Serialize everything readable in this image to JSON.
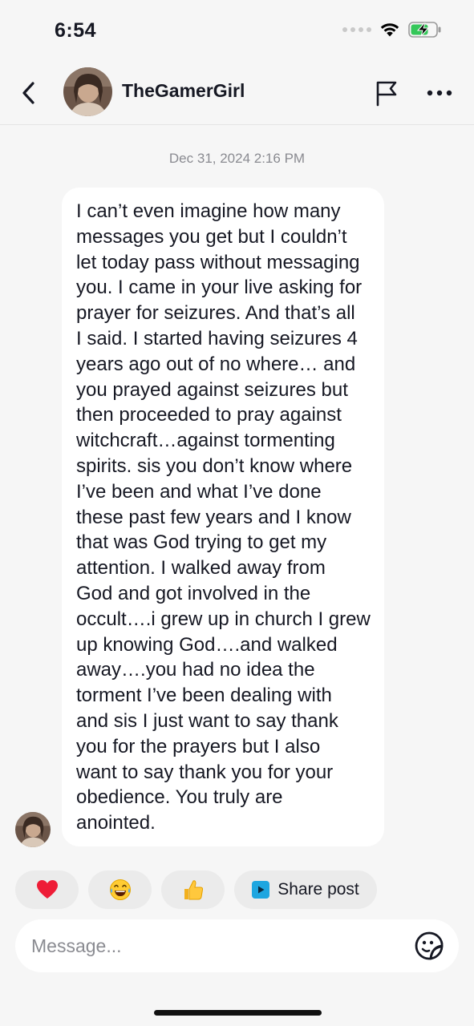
{
  "status_bar": {
    "time": "6:54",
    "icons": [
      "signal-dots-icon",
      "wifi-icon",
      "battery-charging-icon"
    ],
    "battery_color": "#34c759"
  },
  "header": {
    "username": "TheGamerGirl",
    "icons": [
      "back-chevron-icon",
      "avatar",
      "flag-icon",
      "more-horizontal-icon"
    ]
  },
  "chat": {
    "timestamp": "Dec 31, 2024 2:16 PM",
    "message_lines": [
      "I can’t even imagine how many",
      "messages you get but I couldn’t",
      "let today pass without messaging",
      "you. I came in your live asking for",
      "prayer for seizures. And that’s all",
      "I said. I started having seizures 4",
      "years ago out of no where… and",
      "you prayed against seizures  but",
      "then proceeded to pray against",
      "witchcraft…against tormenting",
      "spirits. sis you don’t know where",
      "I’ve been and what I’ve done",
      "these past few years and I know",
      "that was God trying to get my",
      "attention. I walked away from",
      "God and got involved in the",
      "occult….i grew up in church I grew",
      "up knowing God….and walked",
      "away….you had no idea the",
      "torment I’ve been dealing with",
      "and sis I just want to say thank",
      "you for the prayers but I also",
      "want to say thank you for your",
      "obedience. You truly are",
      "anointed."
    ]
  },
  "quick_replies": {
    "emojis": [
      "❤️",
      "😂",
      "👍"
    ],
    "emoji_names": [
      "heart-emoji",
      "laughing-emoji",
      "thumbs-up-emoji"
    ],
    "share_label": "Share post",
    "share_icon": "share-post-icon",
    "share_icon_color": "#1ea6e0"
  },
  "composer": {
    "placeholder": "Message...",
    "icon": "sticker-icon"
  }
}
